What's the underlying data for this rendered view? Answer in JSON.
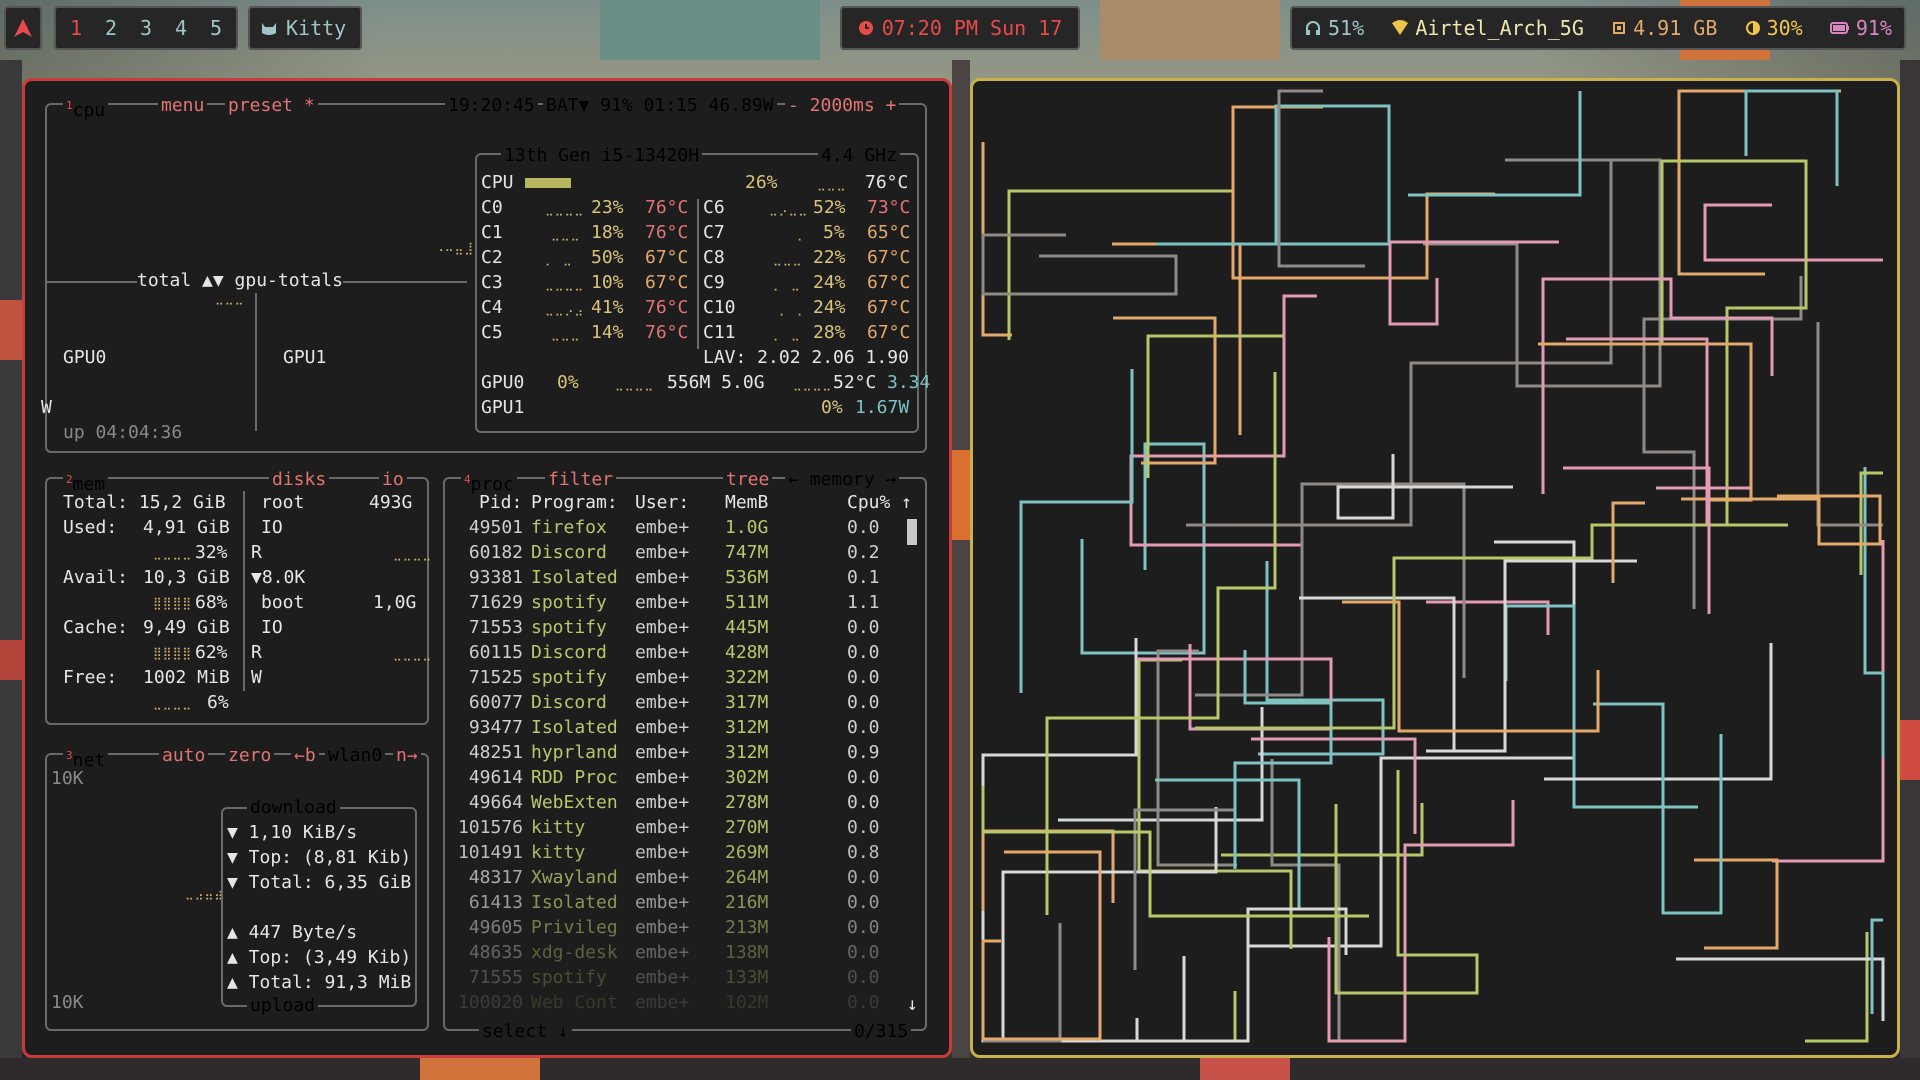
{
  "topbar": {
    "workspaces": [
      "1",
      "2",
      "3",
      "4",
      "5"
    ],
    "active_workspace": "1",
    "app_name": "Kitty",
    "clock": "07:20 PM Sun 17",
    "status": {
      "volume": "51%",
      "wifi": "Airtel_Arch_5G",
      "memory": "4.91 GB",
      "brightness": "30%",
      "battery": "91%"
    }
  },
  "btop": {
    "cpu_box": {
      "tabs": [
        "cpu",
        "menu",
        "preset *"
      ],
      "clock": "19:20:45",
      "battery": "BAT▼ 91% 01:15 46.89W",
      "update": "- 2000ms +",
      "graph_label": "total ▲▼ gpu-totals",
      "gpu0": "GPU0",
      "gpu1": "GPU1",
      "w_label": "W",
      "uptime": "up 04:04:36",
      "cpu_name": "13th Gen i5-13420H",
      "freq": "4.4 GHz",
      "cpu_total": {
        "label": "CPU",
        "pct": "26%",
        "temp": "76°C"
      },
      "cores_left": [
        {
          "name": "C0",
          "pct": "23%",
          "temp": "76°C"
        },
        {
          "name": "C1",
          "pct": "18%",
          "temp": "76°C"
        },
        {
          "name": "C2",
          "pct": "50%",
          "temp": "67°C"
        },
        {
          "name": "C3",
          "pct": "10%",
          "temp": "67°C"
        },
        {
          "name": "C4",
          "pct": "41%",
          "temp": "76°C"
        },
        {
          "name": "C5",
          "pct": "14%",
          "temp": "76°C"
        }
      ],
      "cores_right": [
        {
          "name": "C6",
          "pct": "52%",
          "temp": "73°C"
        },
        {
          "name": "C7",
          "pct": "5%",
          "temp": "65°C"
        },
        {
          "name": "C8",
          "pct": "22%",
          "temp": "67°C"
        },
        {
          "name": "C9",
          "pct": "24%",
          "temp": "67°C"
        },
        {
          "name": "C10",
          "pct": "24%",
          "temp": "67°C"
        },
        {
          "name": "C11",
          "pct": "28%",
          "temp": "67°C"
        }
      ],
      "lav": "LAV: 2.02 2.06 1.90",
      "gpu0_row": {
        "name": "GPU0",
        "pct": "0%",
        "mem": "556M 5.0G",
        "temp": "52°C",
        "watt": "3.34"
      },
      "gpu1_row": {
        "name": "GPU1",
        "pct": "0%",
        "watt": "1.67W"
      }
    },
    "mem_box": {
      "title": "mem",
      "disks_title": "disks",
      "io_title": "io",
      "total": "Total: 15,2 GiB",
      "used_label": "Used:",
      "used": "4,91 GiB",
      "used_pct": "32%",
      "avail_label": "Avail:",
      "avail": "10,3 GiB",
      "avail_pct": "68%",
      "cache_label": "Cache:",
      "cache": "9,49 GiB",
      "cache_pct": "62%",
      "free_label": "Free:",
      "free": "1002 MiB",
      "free_pct": "6%",
      "root": "root",
      "root_size": "493G",
      "io1": "IO",
      "r1": "R",
      "w1": "▼8.0K",
      "boot": "boot",
      "boot_size": "1,0G",
      "io2": "IO",
      "r2": "R",
      "w2": "W"
    },
    "net_box": {
      "title": "net",
      "tabs": [
        "auto",
        "zero",
        "←b",
        "wlan0",
        "n→"
      ],
      "scale_top": "10K",
      "scale_bottom": "10K",
      "download_title": "download",
      "dl_rate": "▼ 1,10 KiB/s",
      "dl_top": "▼ Top: (8,81 Kib)",
      "dl_total": "▼ Total: 6,35 GiB",
      "ul_rate": "▲ 447 Byte/s",
      "ul_top": "▲ Top: (3,49 Kib)",
      "ul_total": "▲ Total: 91,3 MiB",
      "upload_title": "upload"
    },
    "proc_box": {
      "title": "proc",
      "filter": "filter",
      "tree": "tree",
      "sort": "← memory →",
      "headers": {
        "pid": "Pid:",
        "program": "Program:",
        "user": "User:",
        "mem": "MemB",
        "cpu": "Cpu% ↑"
      },
      "rows": [
        {
          "pid": "49501",
          "prog": "firefox",
          "user": "embe+",
          "mem": "1.0G",
          "cpu": "0.0"
        },
        {
          "pid": "60182",
          "prog": "Discord",
          "user": "embe+",
          "mem": "747M",
          "cpu": "0.2"
        },
        {
          "pid": "93381",
          "prog": "Isolated",
          "user": "embe+",
          "mem": "536M",
          "cpu": "0.1"
        },
        {
          "pid": "71629",
          "prog": "spotify",
          "user": "embe+",
          "mem": "511M",
          "cpu": "1.1"
        },
        {
          "pid": "71553",
          "prog": "spotify",
          "user": "embe+",
          "mem": "445M",
          "cpu": "0.0"
        },
        {
          "pid": "60115",
          "prog": "Discord",
          "user": "embe+",
          "mem": "428M",
          "cpu": "0.0"
        },
        {
          "pid": "71525",
          "prog": "spotify",
          "user": "embe+",
          "mem": "322M",
          "cpu": "0.0"
        },
        {
          "pid": "60077",
          "prog": "Discord",
          "user": "embe+",
          "mem": "317M",
          "cpu": "0.0"
        },
        {
          "pid": "93477",
          "prog": "Isolated",
          "user": "embe+",
          "mem": "312M",
          "cpu": "0.0"
        },
        {
          "pid": "48251",
          "prog": "hyprland",
          "user": "embe+",
          "mem": "312M",
          "cpu": "0.9"
        },
        {
          "pid": "49614",
          "prog": "RDD Proc",
          "user": "embe+",
          "mem": "302M",
          "cpu": "0.0"
        },
        {
          "pid": "49664",
          "prog": "WebExten",
          "user": "embe+",
          "mem": "278M",
          "cpu": "0.0"
        },
        {
          "pid": "101576",
          "prog": "kitty",
          "user": "embe+",
          "mem": "270M",
          "cpu": "0.0"
        },
        {
          "pid": "101491",
          "prog": "kitty",
          "user": "embe+",
          "mem": "269M",
          "cpu": "0.8"
        },
        {
          "pid": "48317",
          "prog": "Xwayland",
          "user": "embe+",
          "mem": "264M",
          "cpu": "0.0"
        },
        {
          "pid": "61413",
          "prog": "Isolated",
          "user": "embe+",
          "mem": "216M",
          "cpu": "0.0"
        },
        {
          "pid": "49605",
          "prog": "Privileg",
          "user": "embe+",
          "mem": "213M",
          "cpu": "0.0"
        },
        {
          "pid": "48635",
          "prog": "xdg-desk",
          "user": "embe+",
          "mem": "138M",
          "cpu": "0.0"
        },
        {
          "pid": "71555",
          "prog": "spotify",
          "user": "embe+",
          "mem": "133M",
          "cpu": "0.0"
        },
        {
          "pid": "100020",
          "prog": "Web Cont",
          "user": "embe+",
          "mem": "102M",
          "cpu": "0.0"
        }
      ],
      "select": "select ↓",
      "count": "0/315"
    }
  },
  "colors": {
    "accent": "#e84a4a",
    "teal": "#9fc6c6",
    "bg": "#1d1d1d",
    "left_border": "#cc3b3b",
    "right_border": "#c9b24a"
  },
  "icons": {
    "arch": "arch-logo-icon",
    "kitty": "cat-icon",
    "clock": "clock-icon",
    "headphones": "headphones-icon",
    "wifi": "wifi-icon",
    "memory": "chip-icon",
    "brightness": "brightness-icon",
    "battery": "battery-icon"
  }
}
